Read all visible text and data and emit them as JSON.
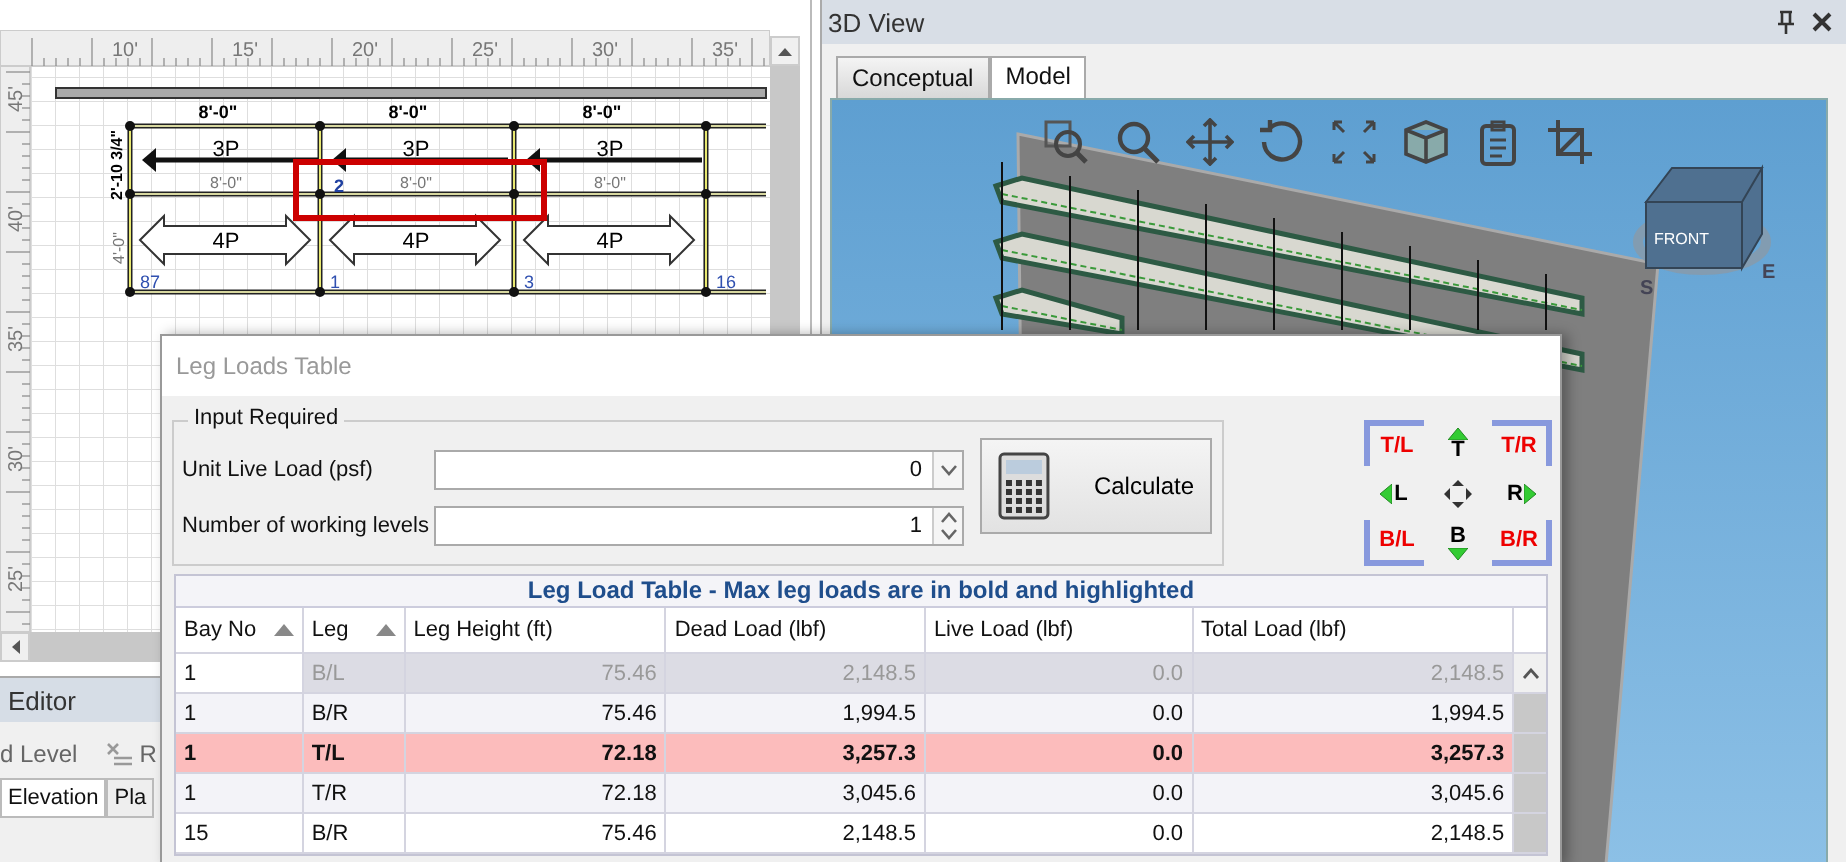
{
  "drawing_pane": {
    "ruler_top": [
      "10'",
      "15'",
      "20'",
      "25'",
      "30'",
      "35'"
    ],
    "ruler_left": [
      "45'",
      "40'",
      "35'",
      "30'",
      "25'"
    ],
    "bay_widths_top": [
      "8'-0\"",
      "8'-0\"",
      "8'-0\""
    ],
    "plank_labels_upper": [
      "3P",
      "3P",
      "3P"
    ],
    "bay_widths_mid": [
      "8'-0\"",
      "8'-0\"",
      "8'-0\""
    ],
    "plank_labels_lower": [
      "4P",
      "4P",
      "4P"
    ],
    "bay_numbers": [
      "87",
      "1",
      "3",
      "16"
    ],
    "leg_number": "2",
    "width_dim": "2'-10 3/4\"",
    "height_dim": "4'-0\""
  },
  "editor": {
    "title": "Editor",
    "toolbar": [
      "d Level",
      "R"
    ],
    "tabs": [
      {
        "label": "Elevation",
        "selected": true
      },
      {
        "label": "Pla",
        "selected": false
      }
    ]
  },
  "view_3d": {
    "title": "3D View",
    "tabs": [
      {
        "label": "Conceptual",
        "selected": false
      },
      {
        "label": "Model",
        "selected": true
      }
    ],
    "view_cube": {
      "face": "FRONT",
      "compass": [
        "S",
        "E"
      ]
    }
  },
  "dialog": {
    "title": "Leg Loads Table",
    "input_group": {
      "title": "Input Required",
      "fields": [
        {
          "label": "Unit Live Load (psf)",
          "value": "0",
          "kind": "dropdown"
        },
        {
          "label": "Number of working levels",
          "value": "1",
          "kind": "spinner"
        }
      ]
    },
    "calculate_button": "Calculate",
    "direction_pad": [
      {
        "label": "T/L",
        "kind": "corner"
      },
      {
        "label": "T",
        "kind": "side"
      },
      {
        "label": "T/R",
        "kind": "corner"
      },
      {
        "label": "L",
        "kind": "side"
      },
      {
        "kind": "center"
      },
      {
        "label": "R",
        "kind": "side"
      },
      {
        "label": "B/L",
        "kind": "corner"
      },
      {
        "label": "B",
        "kind": "side"
      },
      {
        "label": "B/R",
        "kind": "corner"
      }
    ],
    "table": {
      "title": "Leg Load Table - Max leg loads are in bold and highlighted",
      "columns": [
        {
          "label": "Bay No",
          "sorted": true
        },
        {
          "label": "Leg",
          "sorted": true
        },
        {
          "label": "Leg Height (ft)",
          "sorted": false
        },
        {
          "label": "Dead Load (lbf)",
          "sorted": false
        },
        {
          "label": "Live Load (lbf)",
          "sorted": false
        },
        {
          "label": "Total Load (lbf)",
          "sorted": false
        }
      ],
      "rows": [
        {
          "cells": [
            "1",
            "B/L",
            "75.46",
            "2,148.5",
            "0.0",
            "2,148.5"
          ],
          "selected": true,
          "max": false
        },
        {
          "cells": [
            "1",
            "B/R",
            "75.46",
            "1,994.5",
            "0.0",
            "1,994.5"
          ],
          "selected": false,
          "max": false
        },
        {
          "cells": [
            "1",
            "T/L",
            "72.18",
            "3,257.3",
            "0.0",
            "3,257.3"
          ],
          "selected": false,
          "max": true
        },
        {
          "cells": [
            "1",
            "T/R",
            "72.18",
            "3,045.6",
            "0.0",
            "3,045.6"
          ],
          "selected": false,
          "max": false
        },
        {
          "cells": [
            "15",
            "B/R",
            "75.46",
            "2,148.5",
            "0.0",
            "2,148.5"
          ],
          "selected": false,
          "max": false
        }
      ]
    }
  }
}
